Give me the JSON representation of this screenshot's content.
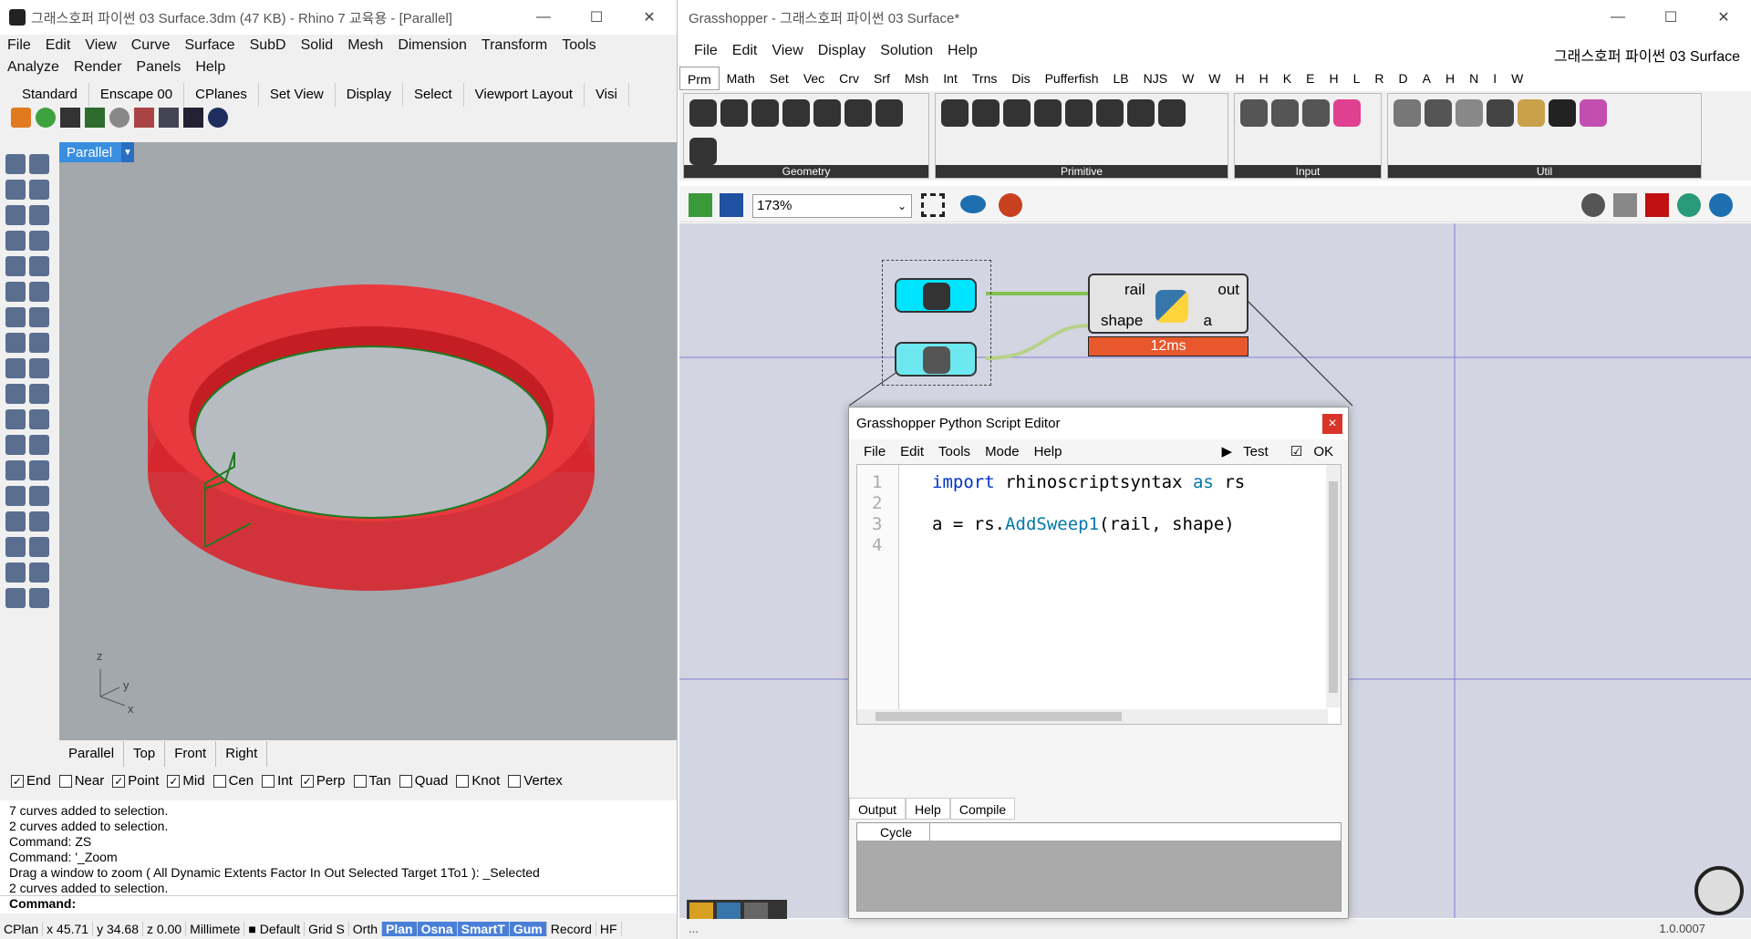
{
  "rhino": {
    "title": "그래스호퍼 파이썬 03 Surface.3dm (47 KB) - Rhino 7 교육용 - [Parallel]",
    "menu": [
      "File",
      "Edit",
      "View",
      "Curve",
      "Surface",
      "SubD",
      "Solid",
      "Mesh",
      "Dimension",
      "Transform",
      "Tools",
      "Analyze",
      "Render",
      "Panels",
      "Help"
    ],
    "tabs": [
      "Standard",
      "Enscape 00",
      "CPlanes",
      "Set View",
      "Display",
      "Select",
      "Viewport Layout",
      "Visi"
    ],
    "viewport_label": "Parallel",
    "axis": {
      "z": "z",
      "y": "y",
      "x": "x"
    },
    "view_tabs": [
      "Parallel",
      "Top",
      "Front",
      "Right"
    ],
    "osnaps": [
      {
        "label": "End",
        "checked": true
      },
      {
        "label": "Near",
        "checked": false
      },
      {
        "label": "Point",
        "checked": true
      },
      {
        "label": "Mid",
        "checked": true
      },
      {
        "label": "Cen",
        "checked": false
      },
      {
        "label": "Int",
        "checked": false
      },
      {
        "label": "Perp",
        "checked": true
      },
      {
        "label": "Tan",
        "checked": false
      },
      {
        "label": "Quad",
        "checked": false
      },
      {
        "label": "Knot",
        "checked": false
      },
      {
        "label": "Vertex",
        "checked": false
      }
    ],
    "history": [
      "7 curves added to selection.",
      "2 curves added to selection.",
      "Command: ZS",
      "Command: '_Zoom",
      "Drag a window to zoom ( All  Dynamic  Extents  Factor  In  Out  Selected  Target  1To1 ): _Selected",
      "2 curves added to selection."
    ],
    "command_label": "Command:",
    "status": [
      {
        "t": "CPlan",
        "on": false
      },
      {
        "t": "x 45.71",
        "on": false
      },
      {
        "t": "y 34.68",
        "on": false
      },
      {
        "t": "z 0.00",
        "on": false
      },
      {
        "t": "Millimete",
        "on": false
      },
      {
        "t": "■ Default",
        "on": false
      },
      {
        "t": "Grid S",
        "on": false
      },
      {
        "t": "Orth",
        "on": false
      },
      {
        "t": "Plan",
        "on": true
      },
      {
        "t": "Osna",
        "on": true
      },
      {
        "t": "SmartT",
        "on": true
      },
      {
        "t": "Gum",
        "on": true
      },
      {
        "t": "Record",
        "on": false
      },
      {
        "t": "HF",
        "on": false
      }
    ]
  },
  "gh": {
    "title": "Grasshopper - 그래스호퍼 파이썬 03 Surface*",
    "doc_name": "그래스호퍼 파이썬 03 Surface",
    "menu": [
      "File",
      "Edit",
      "View",
      "Display",
      "Solution",
      "Help"
    ],
    "tabs": [
      "Prm",
      "Math",
      "Set",
      "Vec",
      "Crv",
      "Srf",
      "Msh",
      "Int",
      "Trns",
      "Dis",
      "Pufferfish",
      "LB",
      "NJS",
      "W",
      "W",
      "H",
      "H",
      "K",
      "E",
      "H",
      "L",
      "R",
      "D",
      "A",
      "H",
      "N",
      "I",
      "W"
    ],
    "groups": [
      "Geometry",
      "Primitive",
      "Input",
      "Util"
    ],
    "zoom": "173%",
    "node": {
      "in1": "rail",
      "in2": "shape",
      "out1": "out",
      "out2": "a",
      "timer": "12ms"
    },
    "version": "1.0.0007",
    "status_left": "..."
  },
  "editor": {
    "title": "Grasshopper Python Script Editor",
    "close": "×",
    "menu": [
      "File",
      "Edit",
      "Tools",
      "Mode",
      "Help"
    ],
    "test": "Test",
    "ok": "OK",
    "line_numbers": [
      "1",
      "2",
      "3",
      "4"
    ],
    "code": {
      "l1_kw1": "import",
      "l1_mod": " rhinoscriptsyntax ",
      "l1_kw2": "as",
      "l1_alias": " rs",
      "l3_a": "a = rs.",
      "l3_fn": "AddSweep1",
      "l3_args": "(rail, shape)"
    },
    "output_tabs": [
      "Output",
      "Help",
      "Compile"
    ],
    "output_row": "Cycle"
  },
  "colors": {
    "ring": "#e8242c",
    "timer": "#e8582c",
    "vp_label": "#3a8ee0",
    "grid_blue": "#7b7fd6",
    "param": "#00e5ff"
  }
}
